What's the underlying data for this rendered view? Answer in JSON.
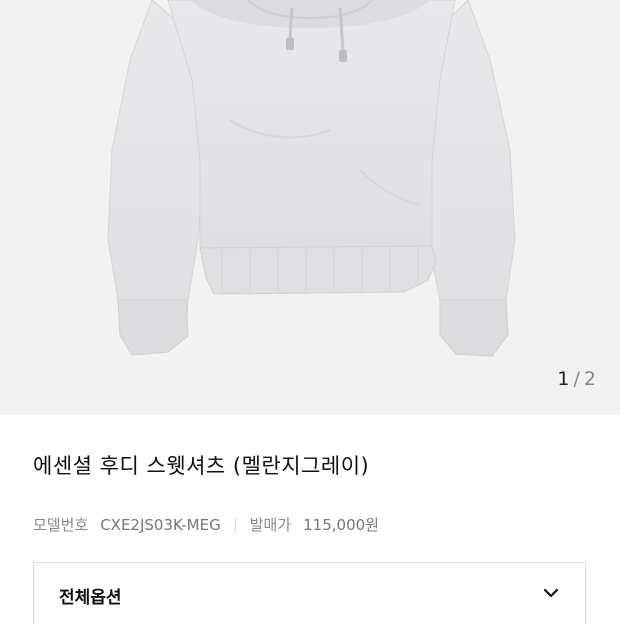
{
  "gallery": {
    "current": "1",
    "separator": "/",
    "total": "2"
  },
  "product": {
    "title": "에센셜 후디 스웻셔츠 (멜란지그레이)",
    "model_label": "모델번호",
    "model_value": "CXE2JS03K-MEG",
    "price_label": "발매가",
    "price_value": "115,000원"
  },
  "options": {
    "label": "전체옵션",
    "icon": "chevron-down-icon"
  },
  "colors": {
    "gallery_bg": "#f2f2f3",
    "hoodie": "#e6e6e8"
  }
}
